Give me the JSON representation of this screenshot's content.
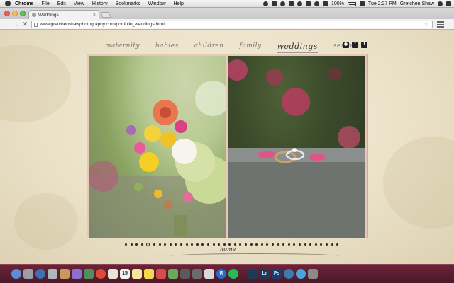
{
  "menubar": {
    "items": [
      "Chrome",
      "File",
      "Edit",
      "View",
      "History",
      "Bookmarks",
      "Window",
      "Help"
    ],
    "battery": "100%",
    "clock": "Tue 2:27 PM",
    "user": "Gretchen Shaw"
  },
  "browser": {
    "tab_title": "Weddings",
    "tab_close": "×",
    "url": "www.gretchenshawphotography.com/portfolio_weddings.html",
    "back": "←",
    "forward": "→",
    "reload": "✕",
    "star": "☆"
  },
  "site": {
    "nav": [
      {
        "label": "maternity",
        "active": false
      },
      {
        "label": "babies",
        "active": false
      },
      {
        "label": "children",
        "active": false
      },
      {
        "label": "family",
        "active": false
      },
      {
        "label": "weddings",
        "active": true
      },
      {
        "label": "seniors",
        "active": false
      }
    ],
    "social": {
      "instagram": "◉",
      "facebook": "f",
      "twitter": "t"
    },
    "slideshow": {
      "dot_count": 40,
      "active_index": 4
    },
    "home_label": "home",
    "photos": [
      {
        "subject": "wedding bouquet of dahlias, roses, hydrangea and wildflowers"
      },
      {
        "subject": "wedding rings on stone ledge with pink flowers"
      }
    ]
  },
  "dock": {
    "icons": [
      "finder-icon",
      "launchpad-icon",
      "safari-icon",
      "mail-icon",
      "contacts-icon",
      "itunes-icon",
      "iphoto-icon",
      "chrome-icon",
      "preview-icon",
      "calendar-icon",
      "notes-icon",
      "stickies-icon",
      "photo-booth-icon",
      "maps-icon",
      "camera-icon",
      "imovie-icon",
      "garageband-icon",
      "rdio-icon",
      "spotify-icon",
      "twitter-icon",
      "lightroom-icon",
      "photoshop-icon",
      "time-machine-icon",
      "app-store-icon",
      "system-preferences-icon"
    ],
    "calendar_day": "15",
    "lightroom_label": "Lr",
    "photoshop_label": "Ps",
    "rdio_label": "R",
    "colors": {
      "accent": "#6b2438",
      "lightroom": "#1f3a54",
      "photoshop": "#1b3c6e"
    }
  }
}
